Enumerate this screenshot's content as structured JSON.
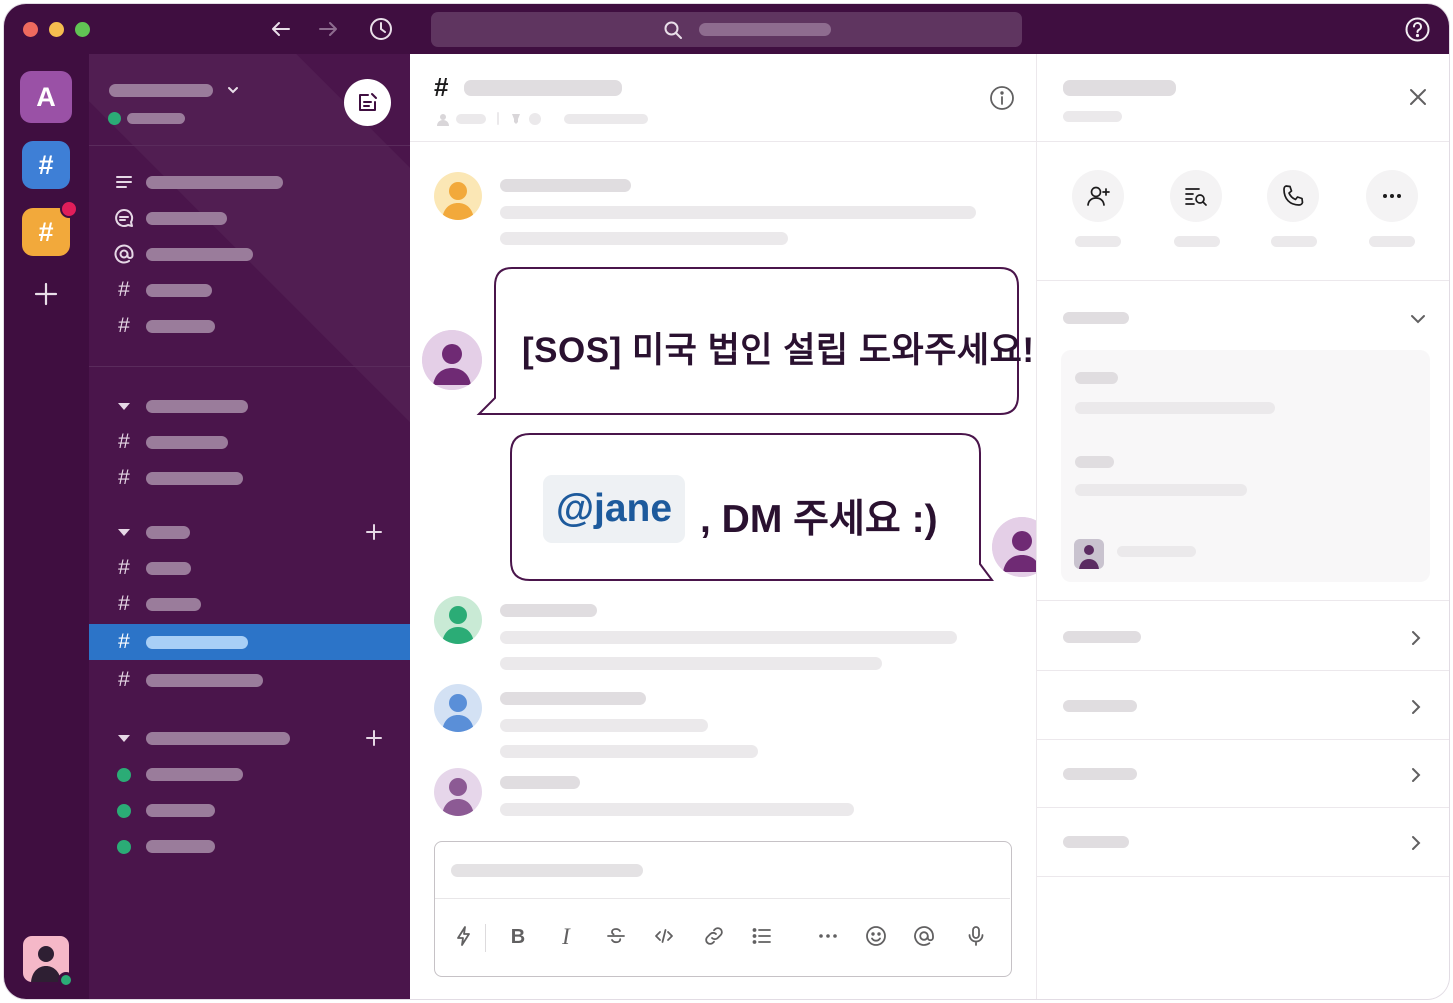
{
  "channel": {
    "hash_symbol": "#"
  },
  "messages": {
    "sos_bubble_text": "[SOS] 미국 법인 설립 도와주세요!",
    "reply_mention": "@jane",
    "reply_text": ", DM 주세요 :)"
  },
  "workspaces": [
    {
      "label": "A",
      "color": "#9a51a6"
    },
    {
      "label": "#",
      "color": "#3e7fd6"
    },
    {
      "label": "#",
      "color": "#f2a93b"
    }
  ],
  "sidebar_hash": "#",
  "composer_tools": {
    "bold": "B",
    "italic": "I"
  },
  "colors": {
    "aubergine": "#4a154b",
    "titlebar": "#3f0e40",
    "active_row": "#2c74c8",
    "online": "#2bac76",
    "mention_badge": "#e01e5a",
    "bubble_border": "#4a154b"
  },
  "icons": {
    "titlebar": [
      "back-arrow-icon",
      "forward-arrow-icon",
      "history-clock-icon",
      "search-icon",
      "help-icon"
    ],
    "sidebar_nav": [
      "threads-icon",
      "dms-icon",
      "mentions-icon",
      "channel-hash-icon",
      "channel-hash-icon"
    ],
    "details_actions": [
      "add-member-icon",
      "search-in-channel-icon",
      "call-icon",
      "more-icon"
    ],
    "composer": [
      "shortcuts-bolt-icon",
      "bold-icon",
      "italic-icon",
      "strikethrough-icon",
      "code-icon",
      "link-icon",
      "bulleted-list-icon",
      "more-icon",
      "emoji-icon",
      "mention-icon",
      "microphone-icon"
    ]
  }
}
